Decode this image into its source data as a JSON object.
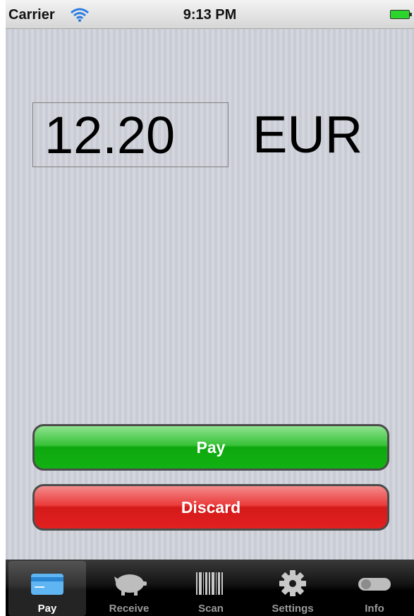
{
  "status_bar": {
    "carrier": "Carrier",
    "time": "9:13 PM"
  },
  "main": {
    "amount": "12.20",
    "currency": "EUR",
    "pay_label": "Pay",
    "discard_label": "Discard"
  },
  "tabs": [
    {
      "label": "Pay",
      "icon": "card-icon",
      "active": true
    },
    {
      "label": "Receive",
      "icon": "piggy-bank-icon",
      "active": false
    },
    {
      "label": "Scan",
      "icon": "barcode-icon",
      "active": false
    },
    {
      "label": "Settings",
      "icon": "gear-icon",
      "active": false
    },
    {
      "label": "Info",
      "icon": "toggle-icon",
      "active": false
    }
  ],
  "colors": {
    "pay": "#12b112",
    "discard": "#e22020",
    "battery": "#2cd52c"
  }
}
